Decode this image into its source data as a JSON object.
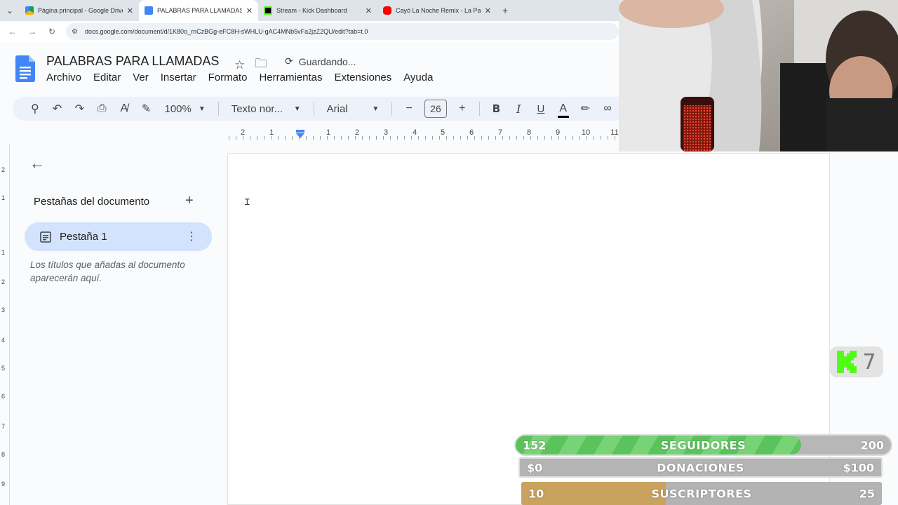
{
  "browser": {
    "tabs": [
      {
        "title": "Página principal - Google Drive",
        "color": "#f4b400"
      },
      {
        "title": "PALABRAS PARA LLAMADAS - G",
        "color": "#4285f4"
      },
      {
        "title": "Stream - Kick Dashboard",
        "color": "#53fc18"
      },
      {
        "title": "Cayó La Noche Remix - La Pant",
        "color": "#ff0000"
      }
    ],
    "url": "docs.google.com/document/d/1K80o_rnCzBGg-eFC8H-sWHLU-gAC4MNb5vFa2jzZ2QU/edit?tab=t.0"
  },
  "doc": {
    "title": "PALABRAS PARA LLAMADAS",
    "status": "Guardando...",
    "menu": [
      "Archivo",
      "Editar",
      "Ver",
      "Insertar",
      "Formato",
      "Herramientas",
      "Extensiones",
      "Ayuda"
    ]
  },
  "toolbar": {
    "zoom": "100%",
    "style": "Texto nor...",
    "font": "Arial",
    "font_size": "26",
    "bold": "B",
    "italic": "I",
    "underline": "U",
    "text_color_glyph": "A"
  },
  "ruler": {
    "marks": [
      "2",
      "1",
      "1",
      "2",
      "3",
      "4",
      "5",
      "6",
      "7",
      "8",
      "9",
      "10",
      "11"
    ],
    "vmarks": [
      "2",
      "1",
      "1",
      "2",
      "3",
      "4",
      "5",
      "6",
      "7",
      "8",
      "9"
    ]
  },
  "sidebar": {
    "heading": "Pestañas del documento",
    "tab_label": "Pestaña 1",
    "hint": "Los títulos que añadas al documento aparecerán aquí."
  },
  "overlay": {
    "kick_count": "7",
    "goals": [
      {
        "current": "152",
        "label": "SEGUIDORES",
        "max": "200",
        "progress": 0.76
      },
      {
        "current": "$0",
        "label": "DONACIONES",
        "max": "$100",
        "progress": 0
      },
      {
        "current": "10",
        "label": "SUSCRIPTORES",
        "max": "25",
        "progress": 0.4
      }
    ]
  }
}
